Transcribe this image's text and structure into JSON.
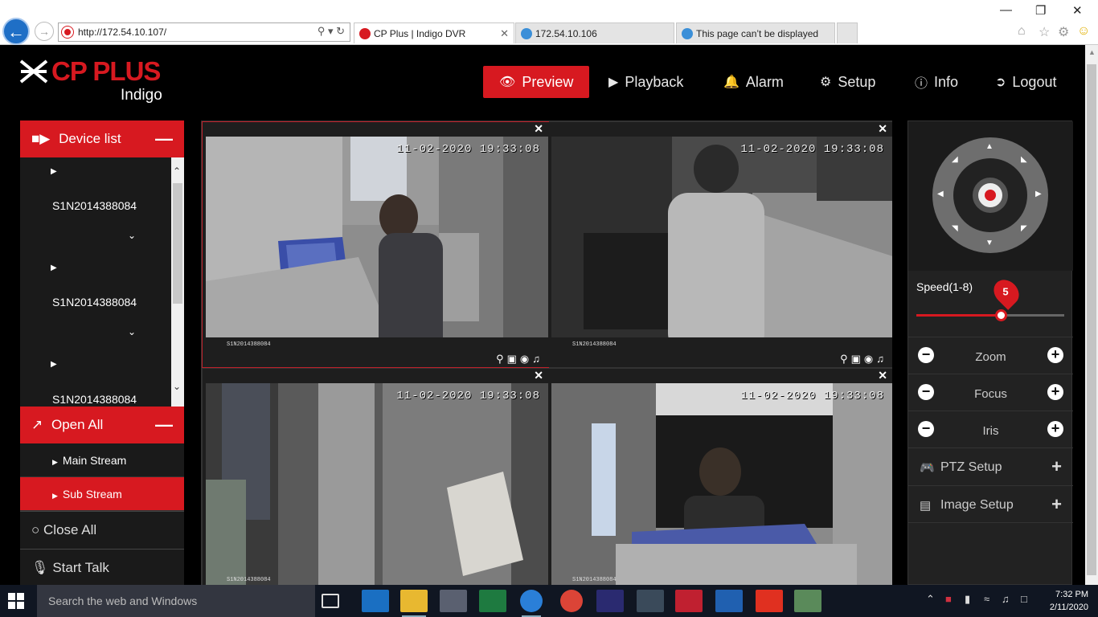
{
  "browser": {
    "url": "http://172.54.10.107/",
    "tabs": [
      {
        "title": "CP Plus | Indigo DVR"
      },
      {
        "title": "172.54.10.106"
      },
      {
        "title": "This page can’t be displayed"
      }
    ]
  },
  "header": {
    "brand": "CP PLUS",
    "brand_sub": "Indigo",
    "nav": [
      {
        "label": "Preview",
        "icon": "eye-icon",
        "active": true
      },
      {
        "label": "Playback",
        "icon": "play-circle-icon"
      },
      {
        "label": "Alarm",
        "icon": "bell-icon"
      },
      {
        "label": "Setup",
        "icon": "gear-icon"
      },
      {
        "label": "Info",
        "icon": "info-icon"
      },
      {
        "label": "Logout",
        "icon": "logout-icon"
      }
    ]
  },
  "sidebar": {
    "device_list_label": "Device list",
    "devices": [
      {
        "name": "S1N2014388084"
      },
      {
        "name": "S1N2014388084"
      },
      {
        "name": "S1N2014388084"
      }
    ],
    "open_all_label": "Open All",
    "streams": [
      {
        "label": "Main Stream",
        "selected": false
      },
      {
        "label": "Sub Stream",
        "selected": true
      }
    ],
    "close_all_label": "Close All",
    "start_talk_label": "Start Talk"
  },
  "cameras": [
    {
      "timestamp": "11-02-2020 19:33:08",
      "channel": "S1N2014388084",
      "selected": true
    },
    {
      "timestamp": "11-02-2020 19:33:08",
      "channel": "S1N2014388084",
      "selected": false
    },
    {
      "timestamp": "11-02-2020 19:33:08",
      "channel": "S1N2014388084",
      "selected": false
    },
    {
      "timestamp": "11-02-2020 19:33:08",
      "channel": "S1N2014388084",
      "selected": false
    }
  ],
  "ptz": {
    "speed_label": "Speed(1-8)",
    "speed_value": "5",
    "speed_fraction": 0.57,
    "zoom_label": "Zoom",
    "focus_label": "Focus",
    "iris_label": "Iris",
    "ptz_setup_label": "PTZ Setup",
    "image_setup_label": "Image Setup"
  },
  "taskbar": {
    "search_placeholder": "Search the web and Windows",
    "time": "7:32 PM",
    "date": "2/11/2020"
  },
  "colors": {
    "accent": "#d71920",
    "panel": "#1a1a1a",
    "taskbar": "#101622"
  }
}
